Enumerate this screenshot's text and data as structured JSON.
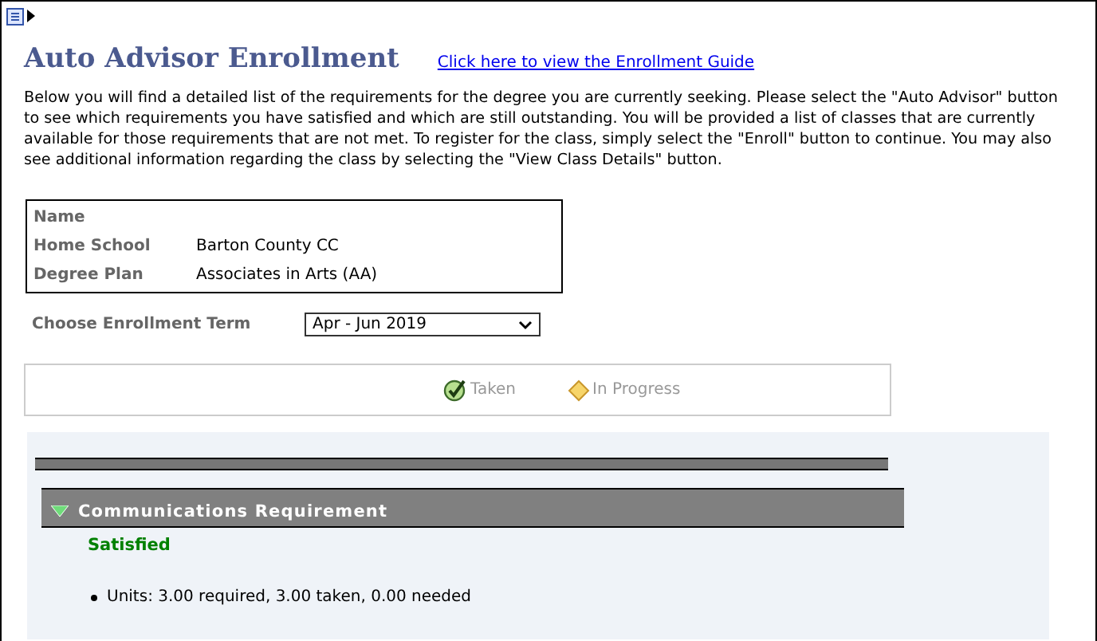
{
  "page": {
    "title": "Auto Advisor Enrollment",
    "guide_link": "Click here to view the Enrollment Guide",
    "intro": "Below you will find a detailed list of the requirements for the degree you are currently seeking. Please select the \"Auto Advisor\" button to see which requirements you have satisfied and which are still outstanding. You will be provided a list of classes that are currently available for those requirements that are not met. To register for the class, simply select the \"Enroll\" button to continue. You may also see additional information regarding the class by selecting the \"View Class Details\" button."
  },
  "student": [
    {
      "label": "Name"
    },
    {
      "label": "Home School",
      "value": "Barton County CC"
    },
    {
      "label": "Degree Plan",
      "value": "Associates in Arts (AA)"
    }
  ],
  "term": {
    "label": "Choose Enrollment Term",
    "value": "Apr - Jun 2019"
  },
  "legend": [
    {
      "kind": "taken",
      "label": "Taken"
    },
    {
      "kind": "in_progress",
      "label": "In Progress"
    }
  ],
  "requirements": [
    {
      "title": "Communications Requirement",
      "expanded": true,
      "status": "Satisfied",
      "details": [
        "Units: 3.00 required, 3.00 taken, 0.00 needed"
      ]
    }
  ]
}
